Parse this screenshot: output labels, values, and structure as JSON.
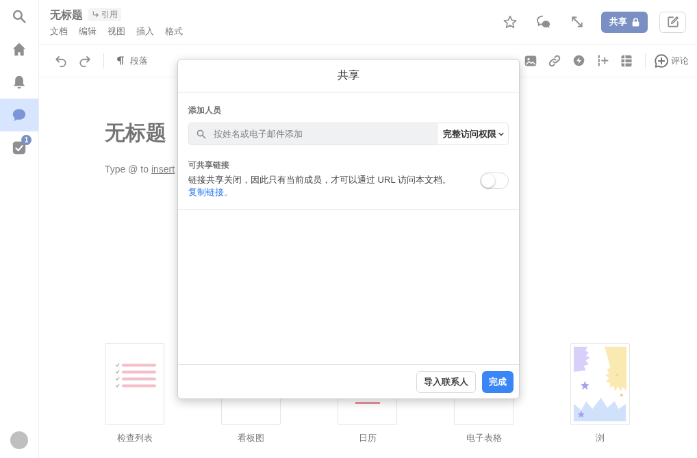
{
  "sidebar": {
    "items": [
      {
        "kind": "search",
        "selected": false
      },
      {
        "kind": "home",
        "selected": false
      },
      {
        "kind": "notifications",
        "selected": false
      },
      {
        "kind": "messages",
        "selected": true
      },
      {
        "kind": "tasks",
        "selected": false,
        "badge": "1"
      }
    ]
  },
  "header": {
    "title": "无标题",
    "cite": "引用",
    "menus": [
      "文档",
      "编辑",
      "视图",
      "插入",
      "格式"
    ],
    "share_button": "共享"
  },
  "toolbar": {
    "paragraph_style": "段落",
    "comment": "评论"
  },
  "editor": {
    "heading": "无标题",
    "hint": "Type @ to",
    "hint_link": "insert"
  },
  "templates": [
    {
      "kind": "checklist",
      "label": "检查列表"
    },
    {
      "kind": "blank",
      "label": "看板图"
    },
    {
      "kind": "calendar",
      "label": "日历"
    },
    {
      "kind": "blank",
      "label": "电子表格"
    },
    {
      "kind": "illustration",
      "label": "浏"
    }
  ],
  "share_dialog": {
    "title": "共享",
    "add_people": {
      "label": "添加人员",
      "placeholder": "按姓名或电子邮件添加",
      "access": "完整访问权限"
    },
    "link_sharing": {
      "label": "可共享链接",
      "description": "链接共享关闭，因此只有当前成员，才可以通过 URL 访问本文档。",
      "copy_link": "复制链接。",
      "on": false
    },
    "buttons": [
      {
        "kind": "secondary",
        "label": "导入联系人"
      },
      {
        "kind": "primary",
        "label": "完成"
      }
    ]
  }
}
